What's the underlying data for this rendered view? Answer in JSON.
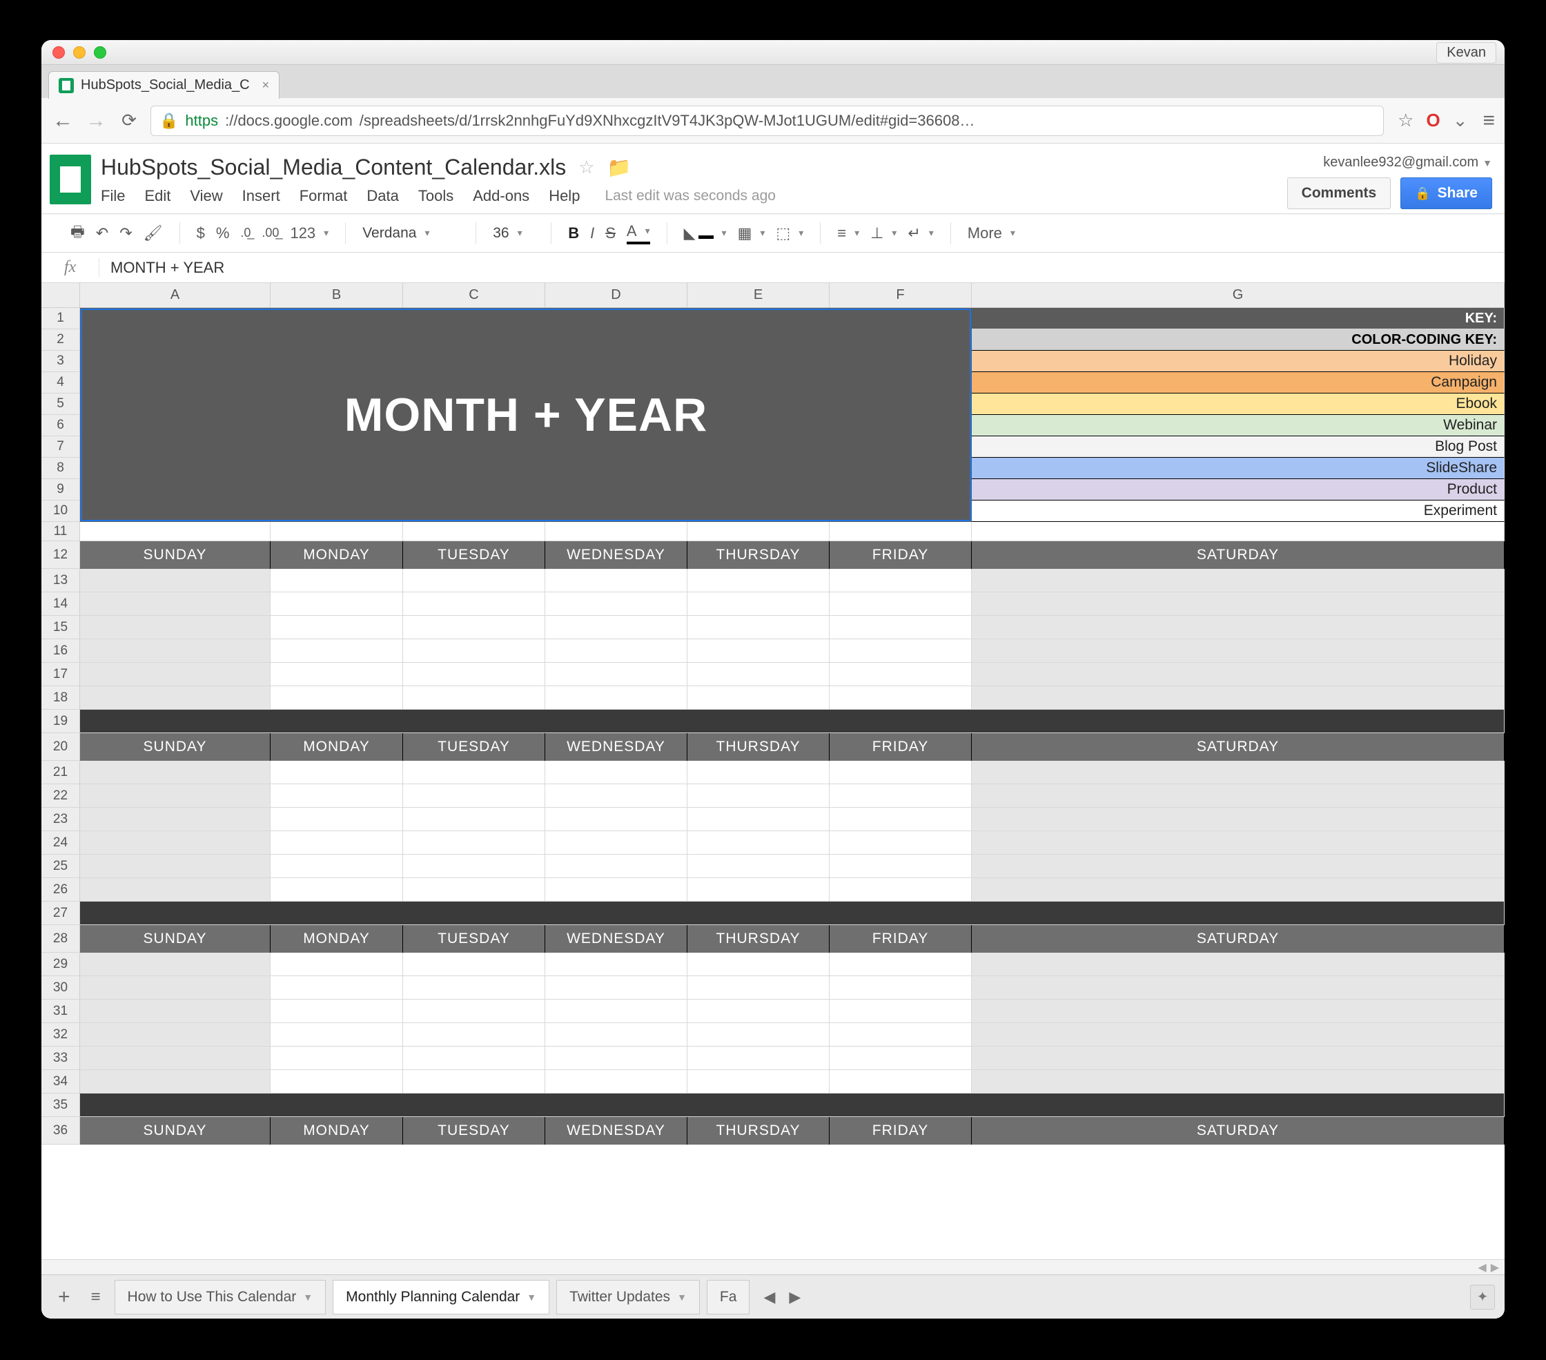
{
  "window": {
    "user_label": "Kevan"
  },
  "browser_tab": {
    "title": "HubSpots_Social_Media_C",
    "close": "×"
  },
  "nav": {
    "url_scheme": "https",
    "url_host": "://docs.google.com",
    "url_path": "/spreadsheets/d/1rrsk2nnhgFuYd9XNhxcgzItV9T4JK3pQW-MJot1UGUM/edit#gid=36608…"
  },
  "doc": {
    "title": "HubSpots_Social_Media_Content_Calendar.xls",
    "menus": [
      "File",
      "Edit",
      "View",
      "Insert",
      "Format",
      "Data",
      "Tools",
      "Add-ons",
      "Help"
    ],
    "last_edit": "Last edit was seconds ago",
    "account_email": "kevanlee932@gmail.com",
    "comments_btn": "Comments",
    "share_btn": "Share"
  },
  "toolbar": {
    "font": "Verdana",
    "font_size": "36",
    "more": "More"
  },
  "formula_bar": {
    "fx": "fx",
    "value": "MONTH + YEAR"
  },
  "columns": [
    "A",
    "B",
    "C",
    "D",
    "E",
    "F",
    "G"
  ],
  "row_numbers": [
    1,
    2,
    3,
    4,
    5,
    6,
    7,
    8,
    9,
    10,
    11,
    12,
    13,
    14,
    15,
    16,
    17,
    18,
    19,
    20,
    21,
    22,
    23,
    24,
    25,
    26,
    27,
    28,
    29,
    30,
    31,
    32,
    33,
    34,
    35,
    36
  ],
  "hero": "MONTH + YEAR",
  "key": {
    "header": "KEY:",
    "subheader": "COLOR-CODING KEY:",
    "items": [
      {
        "label": "Holiday",
        "color": "#f9cb9c"
      },
      {
        "label": "Campaign",
        "color": "#f6b26b"
      },
      {
        "label": "Ebook",
        "color": "#ffe599"
      },
      {
        "label": "Webinar",
        "color": "#d9ead3"
      },
      {
        "label": "Blog Post",
        "color": "#f3f3f3"
      },
      {
        "label": "SlideShare",
        "color": "#a4c2f4"
      },
      {
        "label": "Product",
        "color": "#d9d2e9"
      },
      {
        "label": "Experiment",
        "color": "#ffffff"
      }
    ]
  },
  "days": [
    "SUNDAY",
    "MONDAY",
    "TUESDAY",
    "WEDNESDAY",
    "THURSDAY",
    "FRIDAY",
    "SATURDAY"
  ],
  "sheet_tabs": {
    "items": [
      {
        "label": "How to Use This Calendar",
        "active": false
      },
      {
        "label": "Monthly Planning Calendar",
        "active": true
      },
      {
        "label": "Twitter Updates",
        "active": false
      },
      {
        "label": "Fa",
        "active": false
      }
    ]
  }
}
